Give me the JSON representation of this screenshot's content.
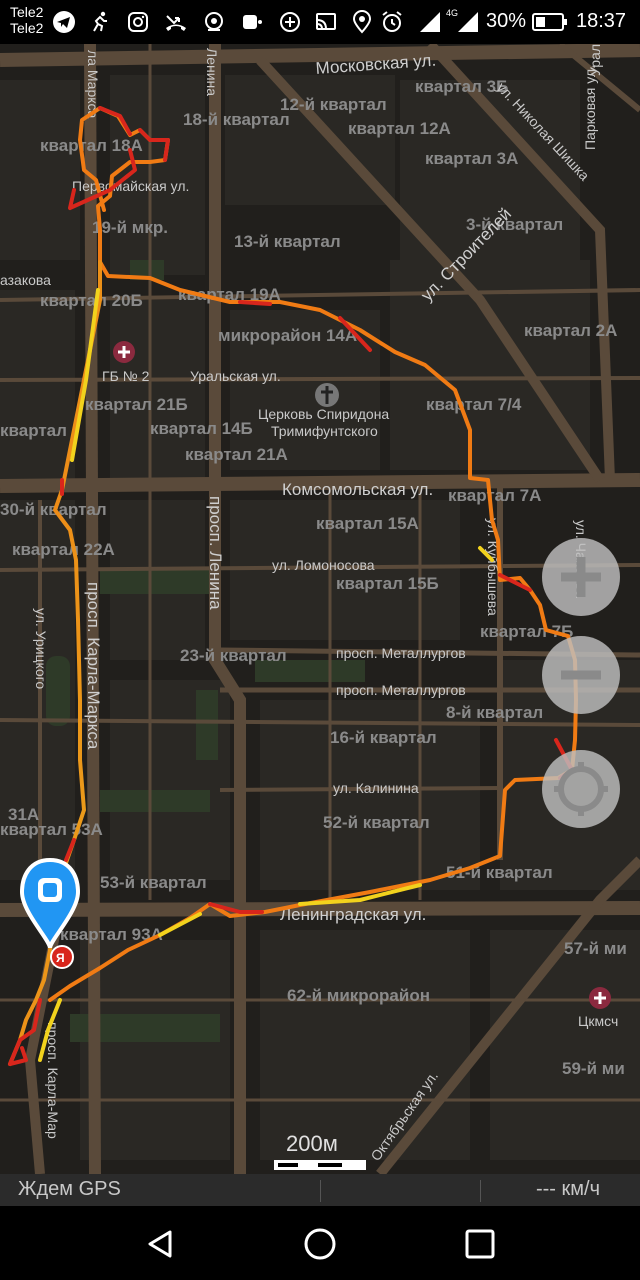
{
  "status_bar": {
    "carrier_1": "Tele2",
    "carrier_2": "Tele2",
    "network": "4G",
    "battery_percent": "30%",
    "time": "18:37"
  },
  "map": {
    "quarters": [
      "12-й квартал",
      "квартал 3Б",
      "18-й квартал",
      "квартал 12А",
      "квартал 18А",
      "квартал 3А",
      "19-й мкр.",
      "3-й квартал",
      "13-й квартал",
      "квартал 20Б",
      "квартал 19А",
      "квартал 2А",
      "микрорайон 14А",
      "квартал 21Б",
      "квартал 7/4",
      "квартал 14Б",
      "квартал",
      "квартал 21А",
      "квартал 7А",
      "30-й квартал",
      "квартал 15А",
      "квартал 22А",
      "квартал 15Б",
      "квартал 7Б",
      "23-й квартал",
      "8-й квартал",
      "16-й квартал",
      "31А",
      "квартал 53А",
      "52-й квартал",
      "53-й квартал",
      "51-й квартал",
      "квартал 93А",
      "57-й ми",
      "62-й микрорайон",
      "59-й ми"
    ],
    "streets": {
      "moskovskaya": "Московская ул.",
      "karla_marksa_top": "ла Маркса",
      "lenina_top": "Ленина",
      "nikolaya_shishka": "ул. Николая Шишка",
      "parkovaya": "Парковая ул.",
      "urala": "Урал",
      "pervomayskaya": "Первомайская ул.",
      "zakova": "азакова",
      "stroiteley": "ул. Строителей",
      "uralskaya": "Уральская ул.",
      "komsomolskaya": "Комсомольская ул.",
      "prosp_lenina": "просп. Ленина",
      "lomonosova": "ул. Ломоносова",
      "prosp_karla_marksa": "просп. Карла-Маркса",
      "uritskogo": "ул. Урицкого",
      "kuibysheva": "ул. Куйбышева",
      "chapaeva": "ул. Чапаева",
      "metallurgov_1": "просп. Металлургов",
      "metallurgov_2": "просп. Металлургов",
      "kalinina": "ул. Калинина",
      "leningradskaya": "Ленинградская ул.",
      "oktyabrskaya": "Октябрьская ул.",
      "karla_mar_bottom": "просп. Карла-Мар"
    },
    "pois": {
      "gb2": "ГБ № 2",
      "church_line1": "Церковь Спиридона",
      "church_line2": "Тримифунтского",
      "ckmsch": "Цкмсч"
    },
    "scale_label": "200м",
    "yandex_badge": "Я"
  },
  "controls": {
    "zoom_in": "+",
    "zoom_out": "−"
  },
  "bottom_bar": {
    "gps_status": "Ждем GPS",
    "speed": "--- км/ч"
  },
  "colors": {
    "track_red": "#d8261c",
    "track_orange": "#f07b14",
    "track_yellow": "#f2d21d",
    "location_pin": "#2196f3",
    "map_bg": "#211f1c",
    "road": "#5a4a3a"
  }
}
